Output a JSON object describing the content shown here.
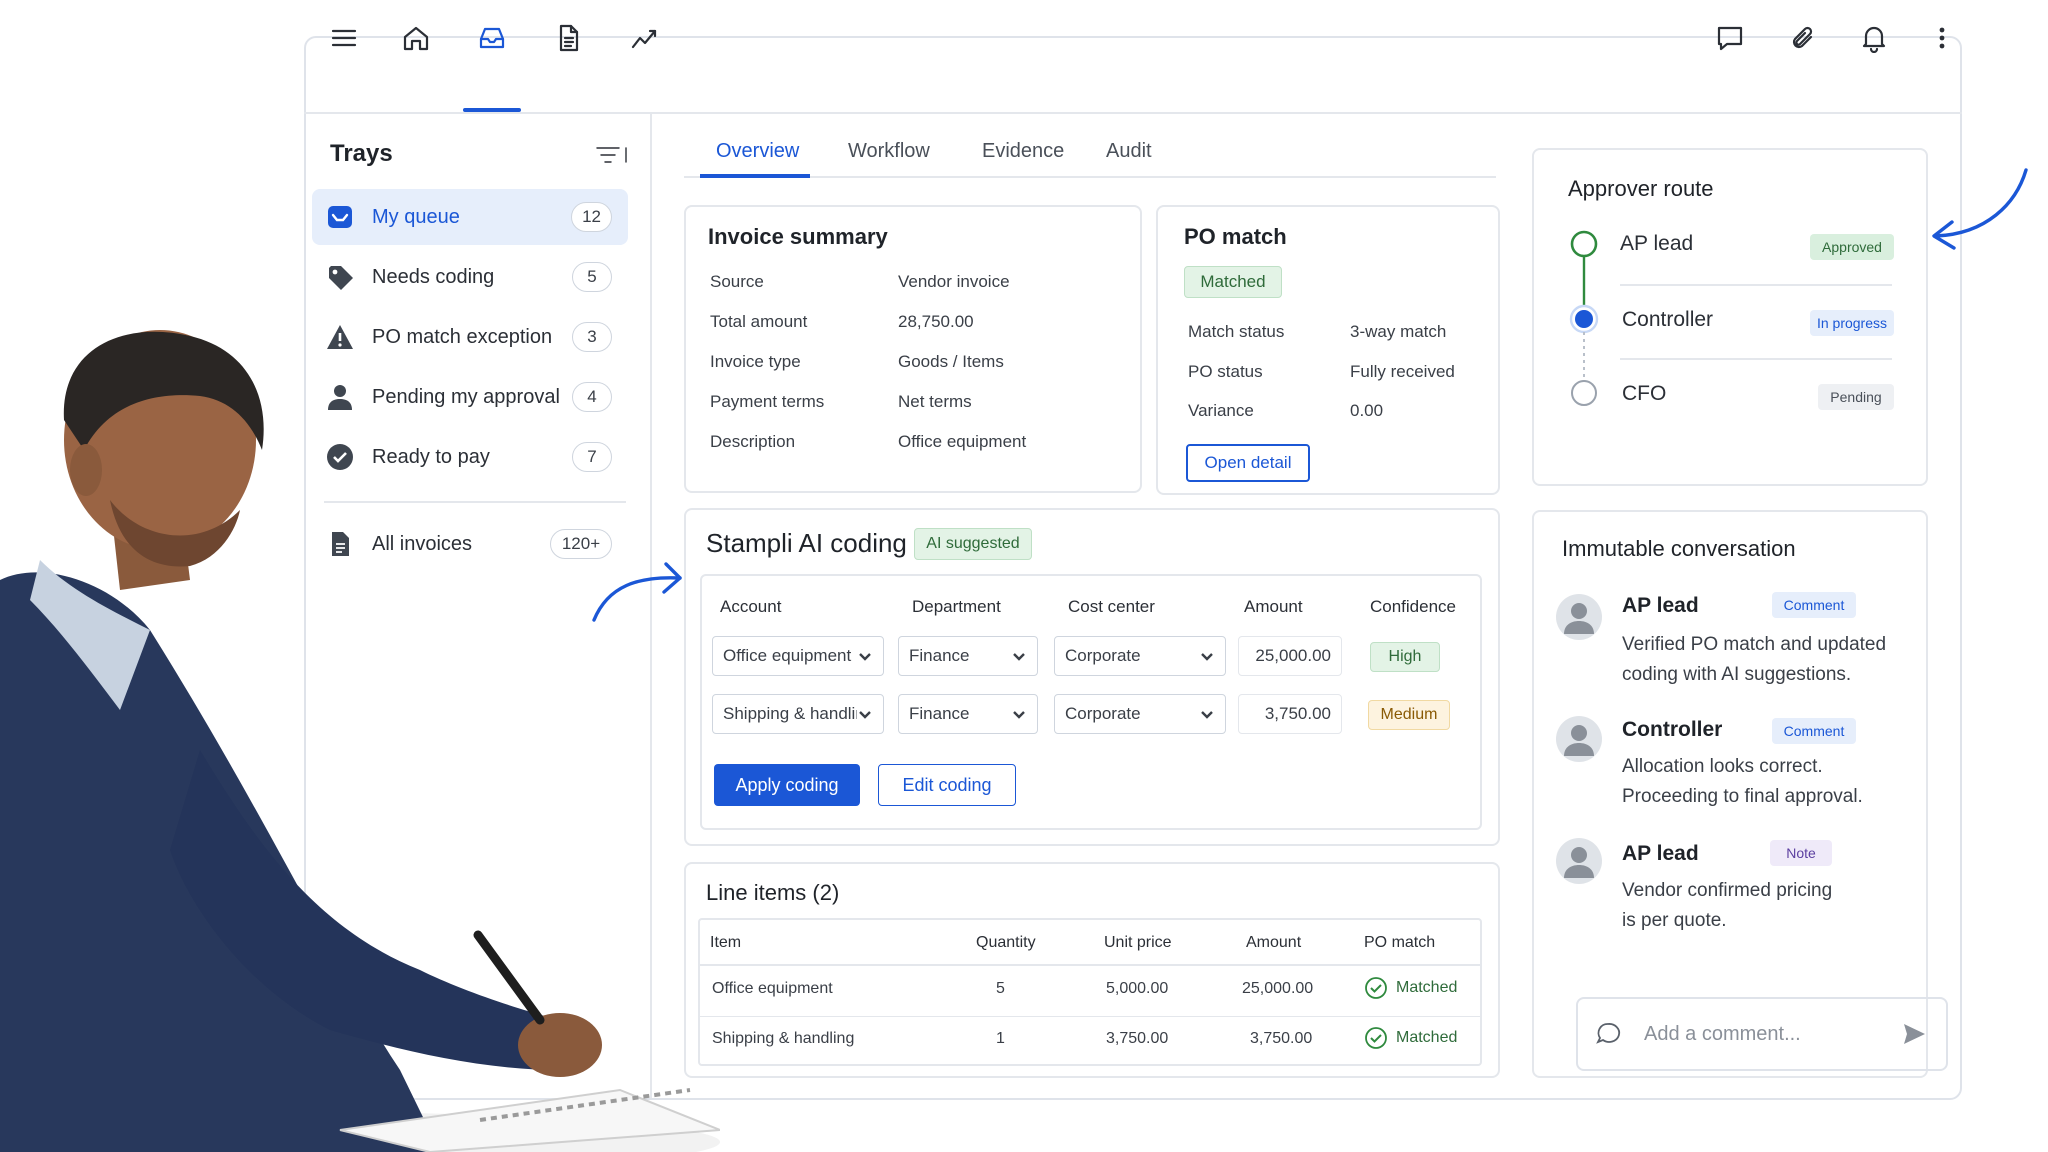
{
  "toolbar": {
    "left_icons": [
      "menu-icon",
      "home-icon",
      "inbox-icon",
      "document-icon",
      "trend-icon"
    ],
    "right_icons": [
      "chat-icon",
      "paperclip-icon",
      "bell-icon",
      "more-vertical-icon"
    ]
  },
  "sidebar": {
    "title": "Trays",
    "items": [
      {
        "label": "My queue",
        "count": "12",
        "icon": "inbox-icon"
      },
      {
        "label": "Needs coding",
        "count": "5",
        "icon": "tag-icon"
      },
      {
        "label": "PO match exception",
        "count": "3",
        "icon": "warning-icon"
      },
      {
        "label": "Pending my approval",
        "count": "4",
        "icon": "user-icon"
      },
      {
        "label": "Ready to pay",
        "count": "7",
        "icon": "check-circle-icon"
      }
    ],
    "all_invoices": {
      "label": "All invoices",
      "count": "120+"
    }
  },
  "tabs": [
    "Overview",
    "Workflow",
    "Evidence",
    "Audit"
  ],
  "invoice_summary": {
    "title": "Invoice summary",
    "rows": [
      {
        "k": "Source",
        "v": "Vendor invoice"
      },
      {
        "k": "Total amount",
        "v": "28,750.00"
      },
      {
        "k": "Invoice type",
        "v": "Goods / Items"
      },
      {
        "k": "Payment terms",
        "v": "Net terms"
      },
      {
        "k": "Description",
        "v": "Office equipment"
      }
    ]
  },
  "po_match": {
    "title": "PO match",
    "badge": "Matched",
    "rows": [
      {
        "k": "Match status",
        "v": "3-way match"
      },
      {
        "k": "PO status",
        "v": "Fully received"
      },
      {
        "k": "Variance",
        "v": "0.00"
      }
    ],
    "button": "Open detail"
  },
  "ai_coding": {
    "title": "Stampli AI coding",
    "badge": "AI suggested",
    "headers": [
      "Account",
      "Department",
      "Cost center",
      "Amount",
      "Confidence"
    ],
    "rows": [
      {
        "account": "Office equipment",
        "department": "Finance",
        "cost_center": "Corporate",
        "amount": "25,000.00",
        "confidence": "High"
      },
      {
        "account": "Shipping & handling",
        "department": "Finance",
        "cost_center": "Corporate",
        "amount": "3,750.00",
        "confidence": "Medium"
      }
    ],
    "apply_label": "Apply coding",
    "edit_label": "Edit coding"
  },
  "line_items": {
    "title": "Line items (2)",
    "headers": [
      "Item",
      "Quantity",
      "Unit price",
      "Amount",
      "PO match"
    ],
    "rows": [
      {
        "item": "Office equipment",
        "quantity": "5",
        "unit_price": "5,000.00",
        "amount": "25,000.00",
        "po_match": "Matched"
      },
      {
        "item": "Shipping & handling",
        "quantity": "1",
        "unit_price": "3,750.00",
        "amount": "3,750.00",
        "po_match": "Matched"
      }
    ]
  },
  "approver_route": {
    "title": "Approver route",
    "steps": [
      {
        "name": "AP lead",
        "status": "Approved"
      },
      {
        "name": "Controller",
        "status": "In progress"
      },
      {
        "name": "CFO",
        "status": "Pending"
      }
    ]
  },
  "conversation": {
    "title": "Immutable conversation",
    "messages": [
      {
        "name": "AP lead",
        "tag": "Comment",
        "text": "Verified PO match and updated coding with AI suggestions."
      },
      {
        "name": "Controller",
        "tag": "Comment",
        "text": "Allocation looks correct. Proceeding to final approval."
      },
      {
        "name": "AP lead",
        "tag": "Note",
        "text": "Vendor confirmed pricing is per quote."
      }
    ],
    "input_placeholder": "Add a comment..."
  },
  "colors": {
    "accent": "#1b57d6",
    "success": "#2f6b3a",
    "warning": "#8a5a05",
    "border": "#e4e7ec"
  }
}
